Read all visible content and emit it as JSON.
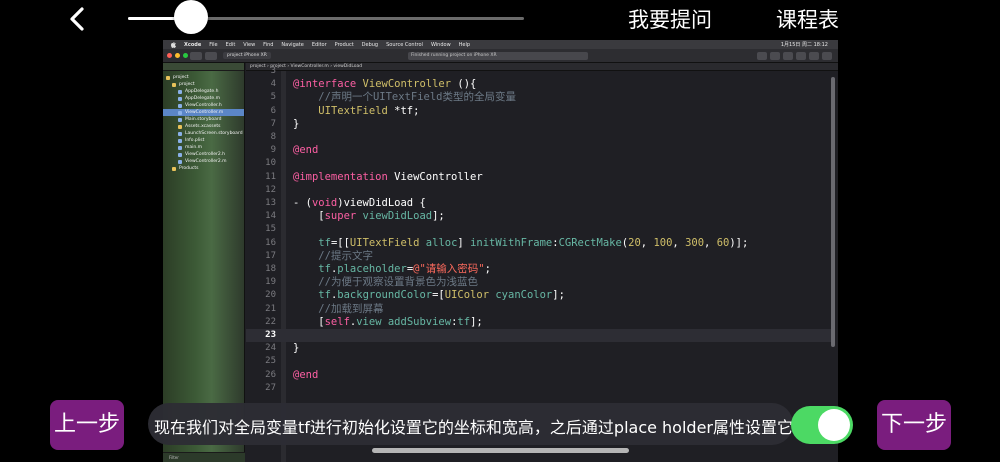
{
  "topbar": {
    "progress": 0.16,
    "ask_label": "我要提问",
    "schedule_label": "课程表"
  },
  "xcode": {
    "menu": [
      "Xcode",
      "File",
      "Edit",
      "View",
      "Find",
      "Navigate",
      "Editor",
      "Product",
      "Debug",
      "Source Control",
      "Window",
      "Help"
    ],
    "clock": "1月15日 周二 18:12",
    "scheme": "project  iPhone XR",
    "status": "Finished running project on iPhone XR",
    "jumpbar": "project  ›  project  ›  ViewController.m  ›  viewDidLoad",
    "tree": [
      {
        "label": "project",
        "type": "folder",
        "indent": 0
      },
      {
        "label": "project",
        "type": "folder",
        "indent": 1
      },
      {
        "label": "AppDelegate.h",
        "type": "file",
        "indent": 2
      },
      {
        "label": "AppDelegate.m",
        "type": "file",
        "indent": 2
      },
      {
        "label": "ViewController.h",
        "type": "file",
        "indent": 2
      },
      {
        "label": "ViewController.m",
        "type": "file",
        "indent": 2,
        "selected": true
      },
      {
        "label": "Main.storyboard",
        "type": "file",
        "indent": 2
      },
      {
        "label": "Assets.xcassets",
        "type": "folder",
        "indent": 2
      },
      {
        "label": "LaunchScreen.storyboard",
        "type": "file",
        "indent": 2
      },
      {
        "label": "Info.plist",
        "type": "file",
        "indent": 2
      },
      {
        "label": "main.m",
        "type": "file",
        "indent": 2
      },
      {
        "label": "ViewController2.h",
        "type": "file",
        "indent": 2
      },
      {
        "label": "ViewController2.m",
        "type": "file",
        "indent": 2
      },
      {
        "label": "Products",
        "type": "folder",
        "indent": 1
      }
    ],
    "filter_label": "Filter",
    "code_lines": [
      {
        "n": "3",
        "html": ""
      },
      {
        "n": "4",
        "html": "<span class='kw'>@interface</span> <span class='tp'>ViewController</span> (){"
      },
      {
        "n": "5",
        "html": "    <span class='cm'>//声明一个UITextField类型的全局变量</span>"
      },
      {
        "n": "6",
        "html": "    <span class='tp'>UITextField</span> *tf;"
      },
      {
        "n": "7",
        "html": "}"
      },
      {
        "n": "8",
        "html": ""
      },
      {
        "n": "9",
        "html": "<span class='kw'>@end</span>"
      },
      {
        "n": "10",
        "html": ""
      },
      {
        "n": "11",
        "html": "<span class='kw'>@implementation</span> ViewController"
      },
      {
        "n": "12",
        "html": ""
      },
      {
        "n": "13",
        "html": "- (<span class='kw'>void</span>)viewDidLoad {"
      },
      {
        "n": "14",
        "html": "    [<span class='kw'>super</span> <span class='meth'>viewDidLoad</span>];"
      },
      {
        "n": "15",
        "html": ""
      },
      {
        "n": "16",
        "html": "    <span class='prop'>tf</span>=[[<span class='tp'>UITextField</span> <span class='meth'>alloc</span>] <span class='meth'>initWithFrame</span>:<span class='meth'>CGRectMake</span>(<span class='num'>20</span>, <span class='num'>100</span>, <span class='num'>300</span>, <span class='num'>60</span>)];"
      },
      {
        "n": "17",
        "html": "    <span class='cm'>//提示文字</span>"
      },
      {
        "n": "18",
        "html": "    <span class='prop'>tf</span>.<span class='prop'>placeholder</span>=<span class='str'>@\"请输入密码\"</span>;"
      },
      {
        "n": "19",
        "html": "    <span class='cm'>//为便于观察设置背景色为浅蓝色</span>"
      },
      {
        "n": "20",
        "html": "    <span class='prop'>tf</span>.<span class='prop'>backgroundColor</span>=[<span class='tp'>UIColor</span> <span class='meth'>cyanColor</span>];"
      },
      {
        "n": "21",
        "html": "    <span class='cm'>//加载到屏幕</span>"
      },
      {
        "n": "22",
        "html": "    [<span class='kw'>self</span>.<span class='prop'>view</span> <span class='meth'>addSubview</span>:<span class='prop'>tf</span>];"
      },
      {
        "n": "23",
        "html": "",
        "active": true
      },
      {
        "n": "24",
        "html": "}"
      },
      {
        "n": "25",
        "html": ""
      },
      {
        "n": "26",
        "html": "<span class='kw'>@end</span>"
      },
      {
        "n": "27",
        "html": ""
      }
    ]
  },
  "caption": {
    "text": "现在我们对全局变量tf进行初始化设置它的坐标和宽高，之后通过place holder属性设置它的占位文字"
  },
  "toggle": {
    "on": true,
    "color": "#4cd964"
  },
  "buttons": {
    "prev_label": "上一步",
    "next_label": "下一步",
    "accent": "#7a1d7e"
  }
}
